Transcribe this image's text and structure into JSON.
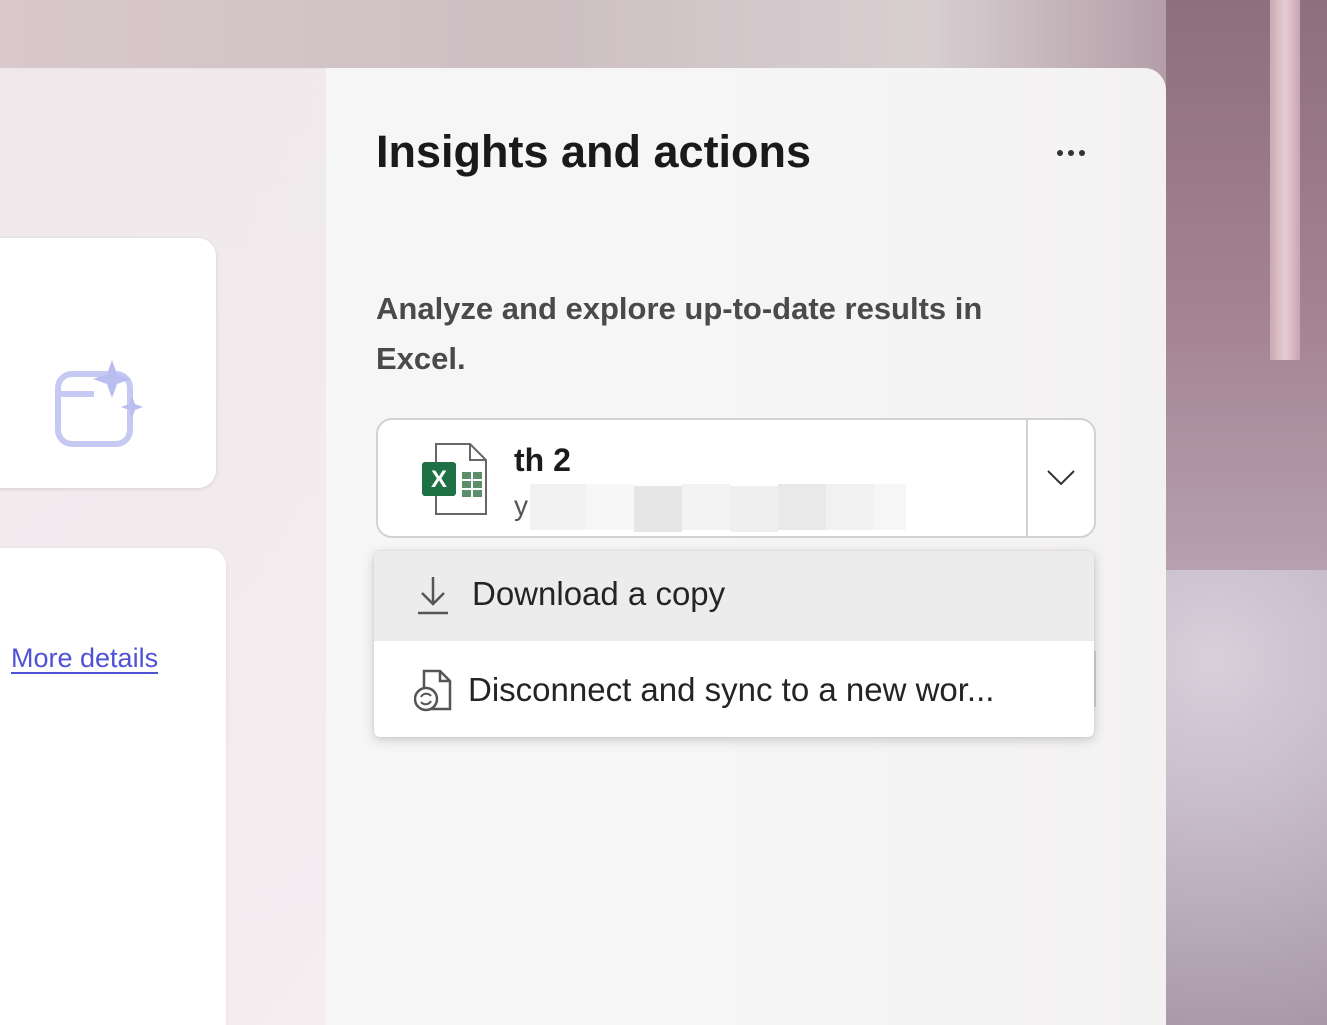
{
  "left_panel": {
    "more_details_link": "More details"
  },
  "panel": {
    "title": "Insights and actions",
    "description": "Analyze and explore up-to-date results in Excel.",
    "file": {
      "name": "th 2",
      "subtitle": "y",
      "icon": "excel-file-icon"
    }
  },
  "menu": {
    "items": [
      {
        "label": "Download a copy",
        "icon": "download-icon"
      },
      {
        "label": "Disconnect and sync to a new wor...",
        "icon": "file-sync-icon"
      }
    ]
  },
  "colors": {
    "link": "#4f52d6",
    "excel_green": "#1e7145",
    "hover_bg": "#ececec"
  }
}
